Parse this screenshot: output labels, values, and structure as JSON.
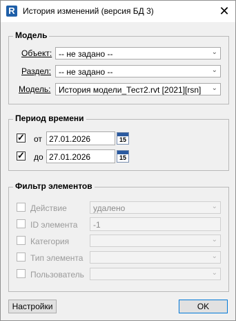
{
  "window": {
    "title": "История изменений (версия БД 3)",
    "icon_letter": "R"
  },
  "model_group": {
    "legend": "Модель",
    "rows": [
      {
        "label": "Объект:",
        "value": "-- не задано --"
      },
      {
        "label": "Раздел:",
        "value": "-- не задано --"
      },
      {
        "label": "Модель:",
        "value": "История модели_Тест2.rvt [2021][rsn]"
      }
    ]
  },
  "period_group": {
    "legend": "Период времени",
    "from": {
      "label": "от",
      "checked": true,
      "value": "27.01.2026"
    },
    "to": {
      "label": "до",
      "checked": true,
      "value": "27.01.2026"
    },
    "calendar_day": "15"
  },
  "filter_group": {
    "legend": "Фильтр элементов",
    "action": {
      "label": "Действие",
      "value": "удалено"
    },
    "element_id": {
      "label": "ID элемента",
      "value": "-1"
    },
    "category": {
      "label": "Категория",
      "value": ""
    },
    "element_type": {
      "label": "Тип элемента",
      "value": ""
    },
    "user": {
      "label": "Пользователь",
      "value": ""
    }
  },
  "buttons": {
    "settings": "Настройки",
    "ok": "OK"
  },
  "icons": {
    "app": "revit-app-icon",
    "close": "close-icon",
    "dropdown": "chevron-down-icon",
    "calendar": "calendar-icon"
  }
}
